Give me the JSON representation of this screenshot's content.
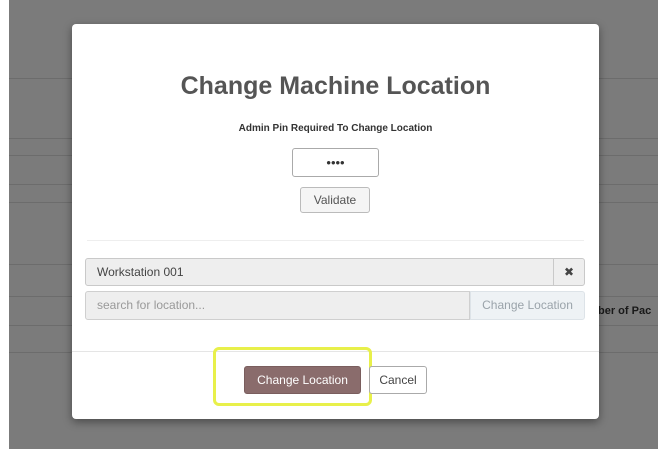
{
  "background": {
    "column_header_fragment": "ber of Pac"
  },
  "modal": {
    "title": "Change Machine Location",
    "pin_label": "Admin Pin Required To Change Location",
    "pin_value": "••••",
    "validate_label": "Validate",
    "current_location": "Workstation 001",
    "clear_icon": "✖",
    "search_placeholder": "search for location...",
    "search_button_label": "Change Location",
    "primary_button_label": "Change Location",
    "cancel_button_label": "Cancel"
  },
  "colors": {
    "primary_button": "#8a6c6c",
    "highlight": "#e8f04a",
    "title": "#555555"
  }
}
